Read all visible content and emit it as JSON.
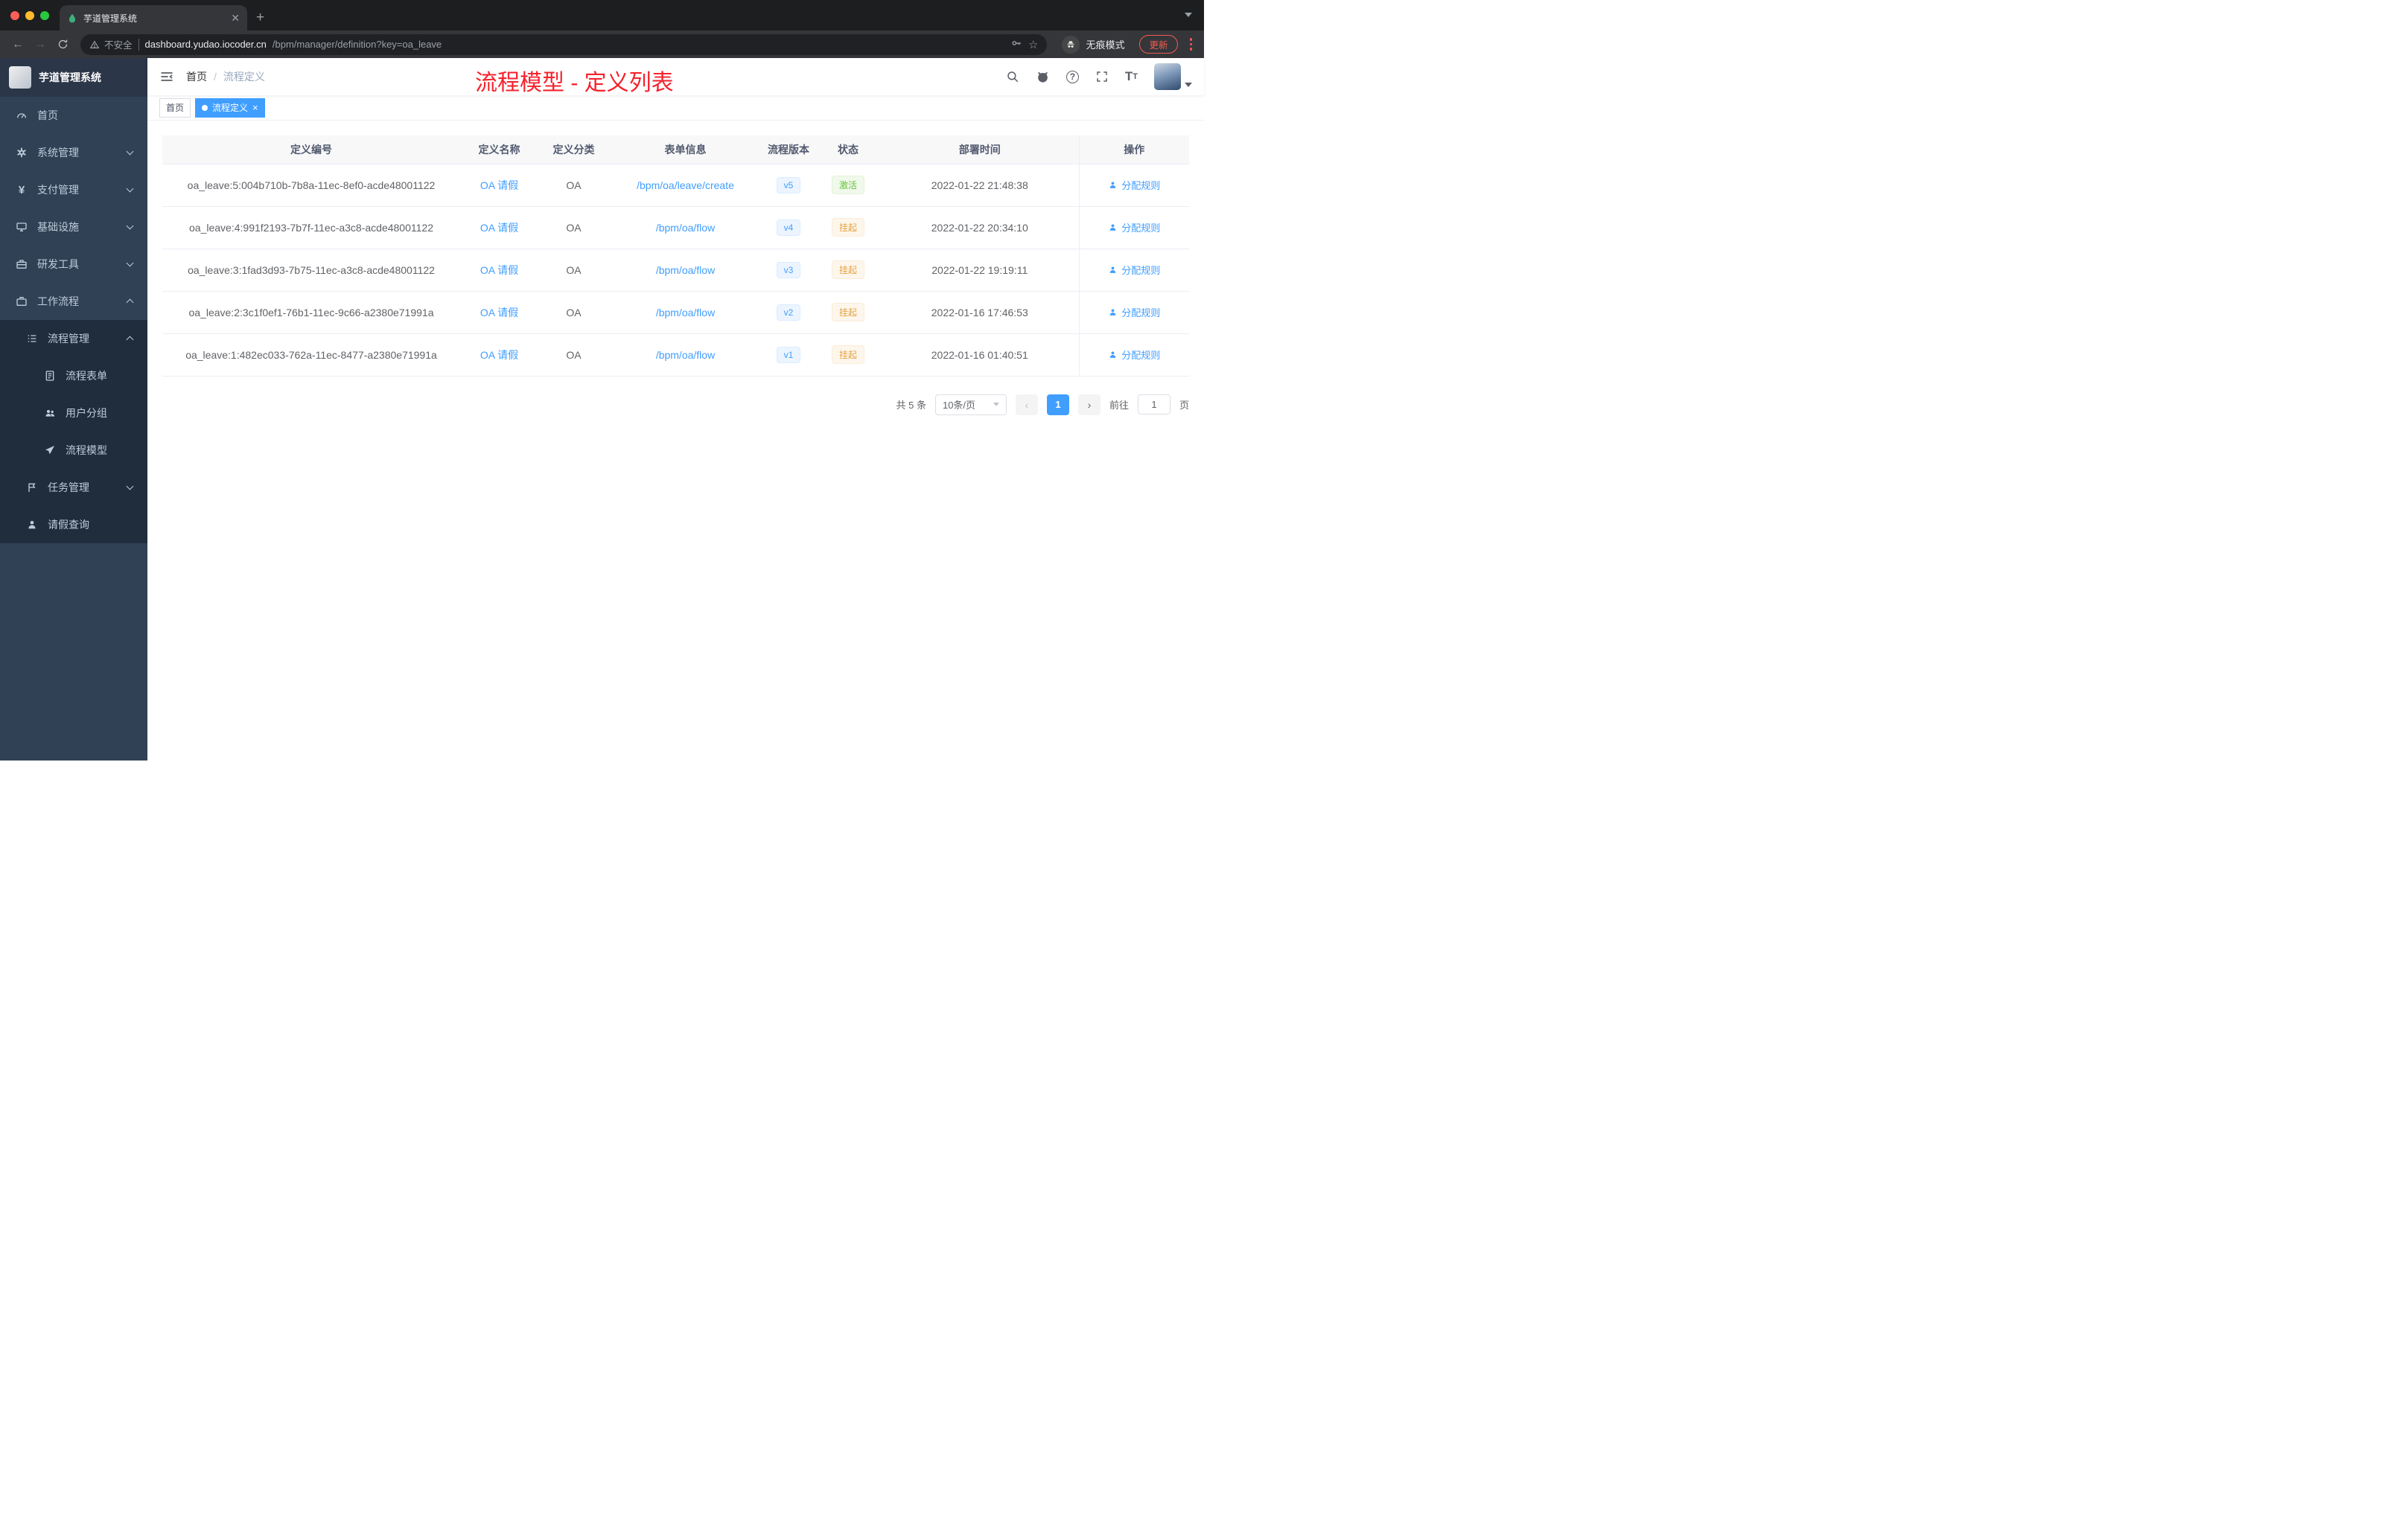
{
  "colors": {
    "accent": "#409eff",
    "success": "#67c23a",
    "warning": "#e6a23c",
    "annotation": "#f5222d",
    "sidebar_bg": "#304156",
    "submenu_bg": "#1f2d3d"
  },
  "browser": {
    "tab_title": "芋道管理系统",
    "security_label": "不安全",
    "url_host": "dashboard.yudao.iocoder.cn",
    "url_path": "/bpm/manager/definition?key=oa_leave",
    "incognito_label": "无痕模式",
    "update_label": "更新"
  },
  "sidebar": {
    "app_title": "芋道管理系统",
    "items": {
      "home": "首页",
      "system": "系统管理",
      "payment": "支付管理",
      "infra": "基础设施",
      "devtools": "研发工具",
      "workflow": "工作流程",
      "process_mgmt": "流程管理",
      "process_form": "流程表单",
      "user_group": "用户分组",
      "process_model": "流程模型",
      "task_mgmt": "任务管理",
      "leave_query": "请假查询"
    }
  },
  "header": {
    "breadcrumb": {
      "home": "首页",
      "separator": "/",
      "current": "流程定义"
    },
    "annotation": "流程模型 - 定义列表"
  },
  "tags": {
    "home": "首页",
    "active": "流程定义",
    "close": "×"
  },
  "table": {
    "columns": {
      "id": "定义编号",
      "name": "定义名称",
      "category": "定义分类",
      "form": "表单信息",
      "version": "流程版本",
      "status": "状态",
      "deploy_time": "部署时间",
      "actions": "操作"
    },
    "rows": [
      {
        "id": "oa_leave:5:004b710b-7b8a-11ec-8ef0-acde48001122",
        "name": "OA 请假",
        "category": "OA",
        "form": "/bpm/oa/leave/create",
        "version": "v5",
        "status": "激活",
        "status_type": "success",
        "deploy_time": "2022-01-22 21:48:38",
        "action": "分配规则"
      },
      {
        "id": "oa_leave:4:991f2193-7b7f-11ec-a3c8-acde48001122",
        "name": "OA 请假",
        "category": "OA",
        "form": "/bpm/oa/flow",
        "version": "v4",
        "status": "挂起",
        "status_type": "warning",
        "deploy_time": "2022-01-22 20:34:10",
        "action": "分配规则"
      },
      {
        "id": "oa_leave:3:1fad3d93-7b75-11ec-a3c8-acde48001122",
        "name": "OA 请假",
        "category": "OA",
        "form": "/bpm/oa/flow",
        "version": "v3",
        "status": "挂起",
        "status_type": "warning",
        "deploy_time": "2022-01-22 19:19:11",
        "action": "分配规则"
      },
      {
        "id": "oa_leave:2:3c1f0ef1-76b1-11ec-9c66-a2380e71991a",
        "name": "OA 请假",
        "category": "OA",
        "form": "/bpm/oa/flow",
        "version": "v2",
        "status": "挂起",
        "status_type": "warning",
        "deploy_time": "2022-01-16 17:46:53",
        "action": "分配规则"
      },
      {
        "id": "oa_leave:1:482ec033-762a-11ec-8477-a2380e71991a",
        "name": "OA 请假",
        "category": "OA",
        "form": "/bpm/oa/flow",
        "version": "v1",
        "status": "挂起",
        "status_type": "warning",
        "deploy_time": "2022-01-16 01:40:51",
        "action": "分配规则"
      }
    ]
  },
  "pagination": {
    "total": "共 5 条",
    "page_size": "10条/页",
    "current_page": "1",
    "goto_label": "前往",
    "goto_value": "1",
    "page_unit": "页"
  }
}
